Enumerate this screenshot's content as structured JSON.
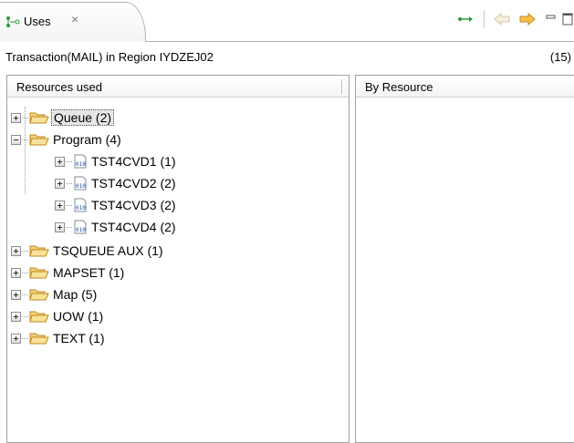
{
  "view": {
    "tab_label": "Uses",
    "tab_close_symbol": "×",
    "tab_icon": "uses-view-icon",
    "toolbar": {
      "link_icon": "link-arrow-icon",
      "back_icon": "back-arrow-icon",
      "forward_icon": "forward-arrow-icon",
      "minimize_icon": "minimize-icon",
      "maximize_icon": "maximize-icon"
    }
  },
  "info": {
    "title": "Transaction(MAIL) in Region IYDZEJ02",
    "count": "(15)"
  },
  "left_pane": {
    "header": "Resources used",
    "tree": [
      {
        "label": "Queue  (2)",
        "expanded": false,
        "selected": true,
        "icon": "folder-icon"
      },
      {
        "label": "Program  (4)",
        "expanded": true,
        "selected": false,
        "icon": "folder-icon",
        "children": [
          {
            "label": "TST4CVD1 (1)",
            "icon": "binary-program-icon"
          },
          {
            "label": "TST4CVD2 (2)",
            "icon": "binary-program-icon"
          },
          {
            "label": "TST4CVD3 (2)",
            "icon": "binary-program-icon"
          },
          {
            "label": "TST4CVD4 (2)",
            "icon": "binary-program-icon"
          }
        ]
      },
      {
        "label": "TSQUEUE AUX  (1)",
        "expanded": false,
        "selected": false,
        "icon": "folder-icon"
      },
      {
        "label": "MAPSET  (1)",
        "expanded": false,
        "selected": false,
        "icon": "folder-icon"
      },
      {
        "label": "Map  (5)",
        "expanded": false,
        "selected": false,
        "icon": "folder-icon"
      },
      {
        "label": "UOW  (1)",
        "expanded": false,
        "selected": false,
        "icon": "folder-icon"
      },
      {
        "label": "TEXT  (1)",
        "expanded": false,
        "selected": false,
        "icon": "folder-icon"
      }
    ]
  },
  "right_pane": {
    "header": "By Resource"
  },
  "colors": {
    "folder_fill": "#f6d77a",
    "folder_stroke": "#c28a1f",
    "arrow_green": "#2a9a3a",
    "arrow_orange": "#f2a62a",
    "border": "#a0a0a0"
  }
}
